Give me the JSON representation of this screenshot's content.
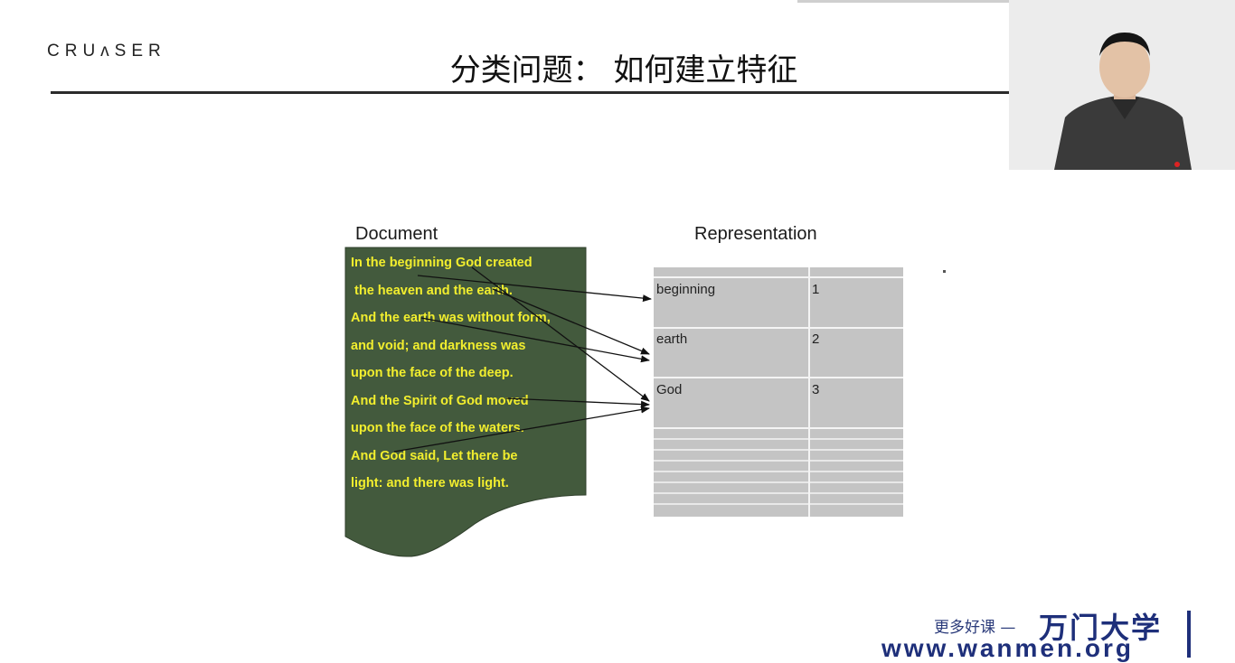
{
  "header": {
    "logo": "CRUʌSER",
    "title": "分类问题：  如何建立特征"
  },
  "diagram": {
    "document_label": "Document",
    "representation_label": "Representation",
    "document_lines": [
      "In the beginning God created",
      " the heaven and the earth.",
      "And the earth was without form,",
      "and void; and darkness was",
      "upon the face of the deep.",
      "And the Spirit of God moved",
      "upon the face of the waters.",
      "And God said, Let there be",
      "light: and there was light."
    ],
    "representation_rows": [
      {
        "term": "beginning",
        "count": "1"
      },
      {
        "term": "earth",
        "count": "2"
      },
      {
        "term": "God",
        "count": "3"
      }
    ],
    "colors": {
      "document_fill": "#435a3d",
      "document_text": "#f2ee2e",
      "table_fill": "#c4c4c4"
    }
  },
  "branding": {
    "tagline": "更多好课 —",
    "name": "万门大学",
    "url": "www.wanmen.org"
  },
  "webcam": {
    "icon": "presenter-video"
  }
}
